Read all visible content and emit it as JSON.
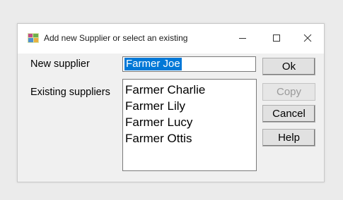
{
  "window": {
    "title": "Add new Supplier or select an existing",
    "icon": "supplier-app-icon",
    "controls": [
      "minimize-icon",
      "maximize-icon",
      "close-icon"
    ]
  },
  "form": {
    "new_supplier_label": "New supplier",
    "new_supplier_value": "Farmer Joe",
    "existing_label": "Existing suppliers",
    "existing_items": [
      "Farmer Charlie",
      "Farmer Lily",
      "Farmer Lucy",
      "Farmer Ottis"
    ]
  },
  "buttons": {
    "ok": "Ok",
    "copy": "Copy",
    "cancel": "Cancel",
    "help": "Help"
  },
  "colors": {
    "selection": "#0078d7",
    "dialog_bg": "#f0f0f0",
    "page_bg": "#ebebeb"
  }
}
